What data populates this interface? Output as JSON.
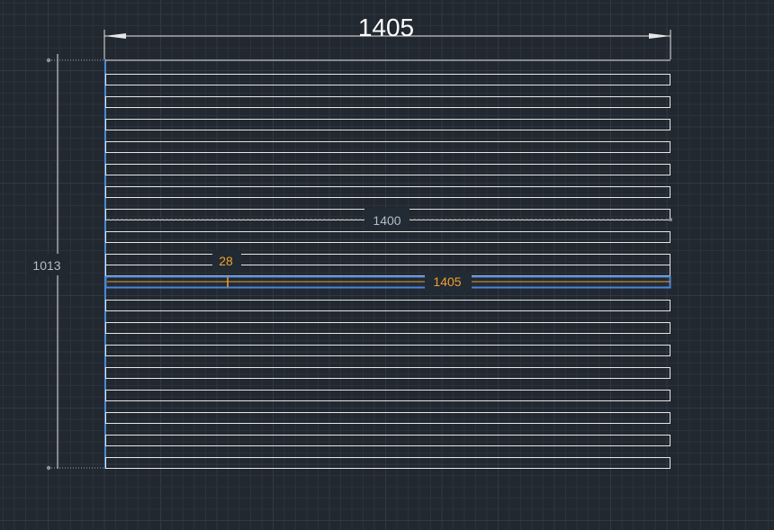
{
  "drawing": {
    "top_dimension": "1405",
    "left_dimension": "1013",
    "inner_dimension": "1400",
    "selected_length": "1405",
    "selected_offset": "28",
    "slat_count_above": 10,
    "slat_count_below": 8,
    "colors": {
      "background": "#212830",
      "grid_minor": "#2a323c",
      "grid_major": "#303946",
      "geometry": "#e6e6e6",
      "selection": "#4a86d8",
      "dimension_dynamic": "#f0a030",
      "dimension_static": "#b4bcc6",
      "label_bg": "#222a33"
    }
  }
}
